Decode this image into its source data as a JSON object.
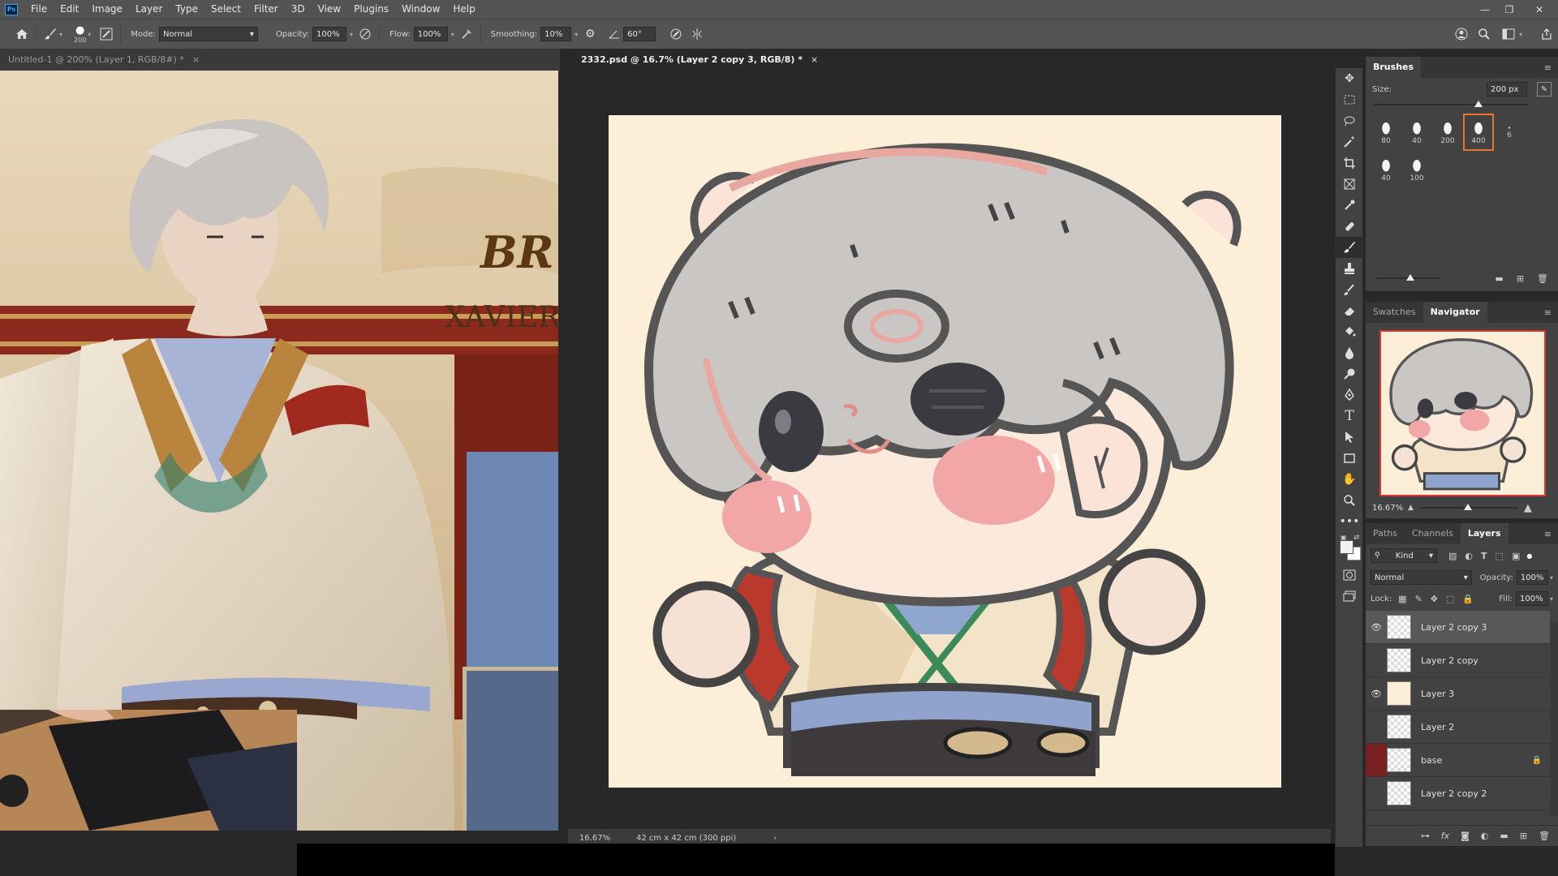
{
  "menubar": {
    "logo": "Ps",
    "items": [
      "File",
      "Edit",
      "Image",
      "Layer",
      "Type",
      "Select",
      "Filter",
      "3D",
      "View",
      "Plugins",
      "Window",
      "Help"
    ]
  },
  "options": {
    "brush_size": "200",
    "mode_label": "Mode:",
    "mode_value": "Normal",
    "opacity_label": "Opacity:",
    "opacity_value": "100%",
    "flow_label": "Flow:",
    "flow_value": "100%",
    "smoothing_label": "Smoothing:",
    "smoothing_value": "10%",
    "angle_value": "60°"
  },
  "tabs": {
    "left": "Untitled-1 @ 200% (Layer 1, RGB/8#) *",
    "right": "2332.psd @ 16.7% (Layer 2 copy 3, RGB/8) *"
  },
  "reference": {
    "title_partial": "BR",
    "name": "XAVIER"
  },
  "status": {
    "zoom": "16.67%",
    "doc_size": "42 cm x 42 cm (300 ppi)"
  },
  "brushes_panel": {
    "title": "Brushes",
    "size_label": "Size:",
    "size_value": "200 px",
    "presets": [
      "80",
      "40",
      "200",
      "400",
      "6",
      "40",
      "100"
    ]
  },
  "nav_panel": {
    "tabs": [
      "Swatches",
      "Navigator"
    ],
    "zoom": "16.67%"
  },
  "layers_panel": {
    "tabs": [
      "Paths",
      "Channels",
      "Layers"
    ],
    "filter_kind": "Kind",
    "blend_mode": "Normal",
    "opacity_label": "Opacity:",
    "opacity_value": "100%",
    "lock_label": "Lock:",
    "fill_label": "Fill:",
    "fill_value": "100%",
    "layers": [
      {
        "name": "Layer 2 copy 3",
        "visible": true,
        "selected": true
      },
      {
        "name": "Layer 2 copy",
        "visible": false,
        "selected": false
      },
      {
        "name": "Layer 3",
        "visible": true,
        "selected": false
      },
      {
        "name": "Layer 2",
        "visible": false,
        "selected": false
      },
      {
        "name": "base",
        "visible": false,
        "selected": false,
        "locked": true
      },
      {
        "name": "Layer 2 copy 2",
        "visible": false,
        "selected": false
      }
    ]
  },
  "colors": {
    "canvas_bg": "#fdeed8",
    "accent": "#e8762c",
    "ps_blue": "#31a8ff"
  }
}
